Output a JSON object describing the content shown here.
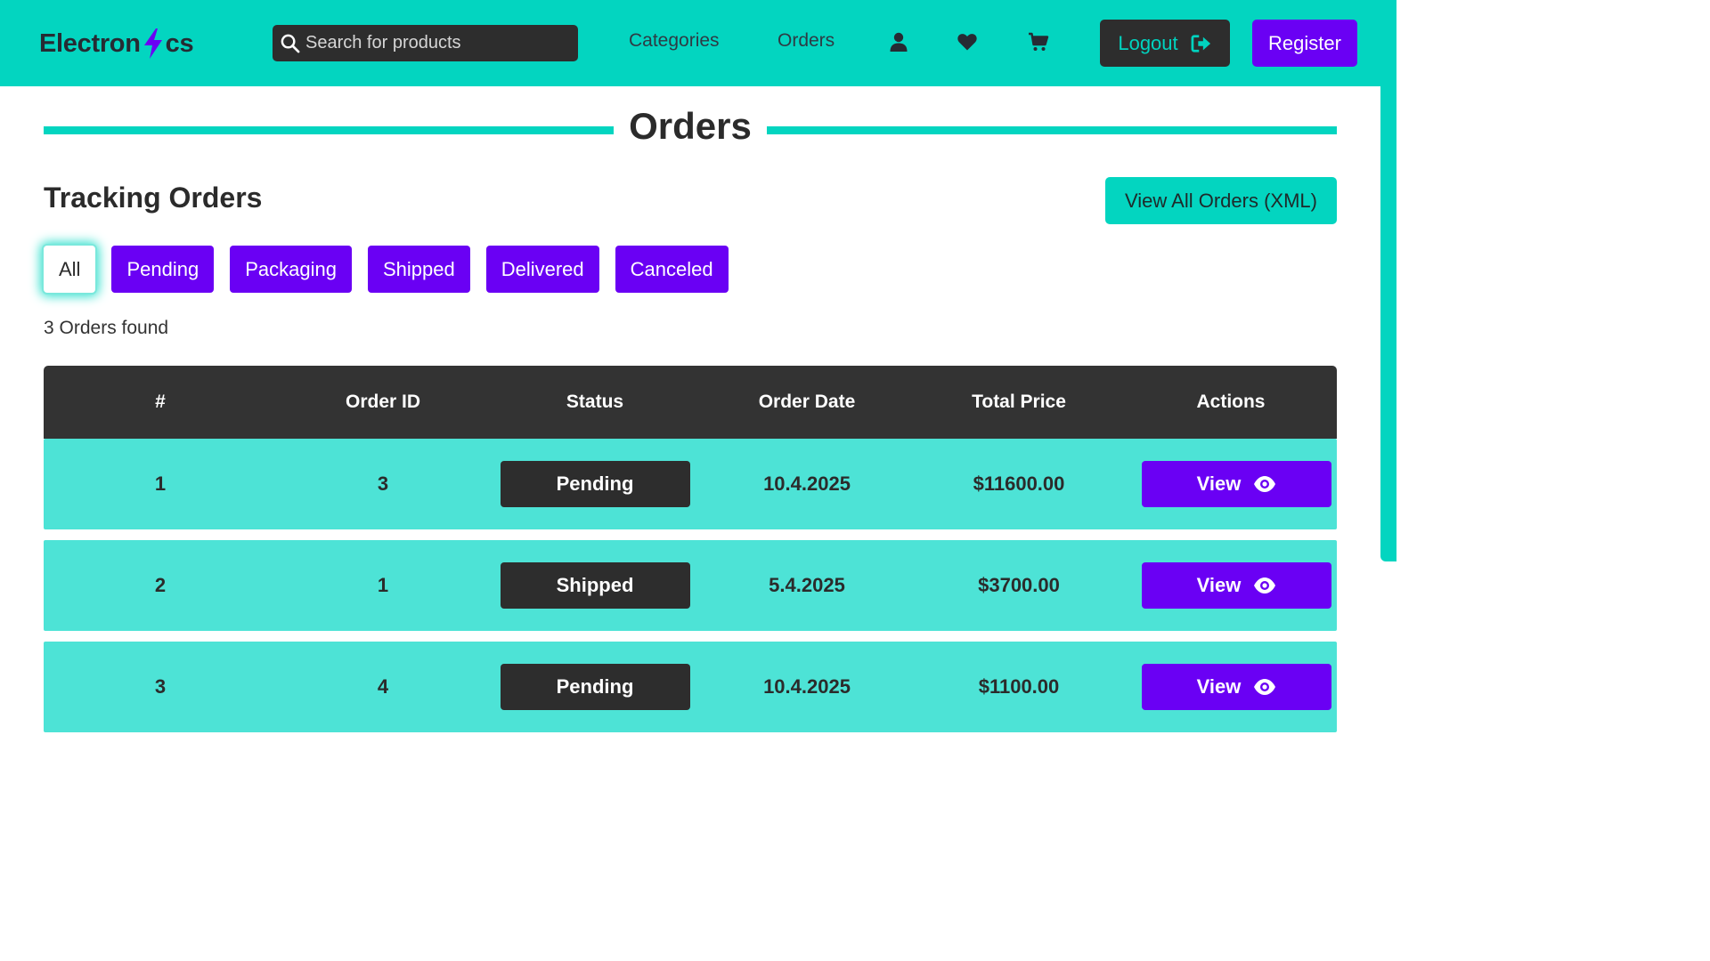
{
  "header": {
    "logo_left": "Electron",
    "logo_right": "cs",
    "search_placeholder": "Search for products",
    "nav": {
      "categories": "Categories",
      "orders": "Orders"
    },
    "icons": [
      "user-icon",
      "heart-icon",
      "cart-icon"
    ],
    "logout_label": "Logout",
    "register_label": "Register"
  },
  "page": {
    "title": "Orders",
    "section_title": "Tracking Orders",
    "xml_button": "View All Orders (XML)",
    "filters": [
      "All",
      "Pending",
      "Packaging",
      "Shipped",
      "Delivered",
      "Canceled"
    ],
    "active_filter": "All",
    "count_text": "3 Orders found"
  },
  "table": {
    "headers": [
      "#",
      "Order ID",
      "Status",
      "Order Date",
      "Total Price",
      "Actions"
    ],
    "rows": [
      {
        "index": "1",
        "order_id": "3",
        "status": "Pending",
        "date": "10.4.2025",
        "total": "$11600.00",
        "action": "View"
      },
      {
        "index": "2",
        "order_id": "1",
        "status": "Shipped",
        "date": "5.4.2025",
        "total": "$3700.00",
        "action": "View"
      },
      {
        "index": "3",
        "order_id": "4",
        "status": "Pending",
        "date": "10.4.2025",
        "total": "$1100.00",
        "action": "View"
      }
    ]
  },
  "colors": {
    "accent": "#03d5c0",
    "primary": "#6a00f4",
    "dark": "#2d2d2d",
    "row_bg": "#4de3d6"
  }
}
